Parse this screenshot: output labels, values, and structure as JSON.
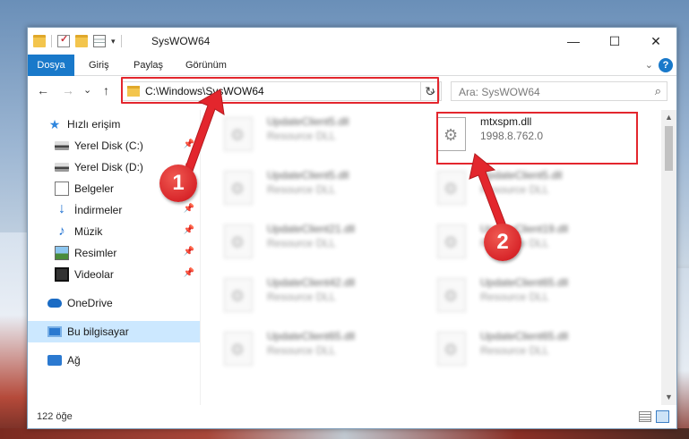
{
  "window": {
    "title": "SysWOW64",
    "controls": {
      "minimize": "—",
      "maximize": "☐",
      "close": "✕"
    }
  },
  "ribbon": {
    "tabs": [
      "Dosya",
      "Giriş",
      "Paylaş",
      "Görünüm"
    ],
    "help": "?"
  },
  "navigation": {
    "back": "←",
    "forward": "→",
    "recent": "⌄",
    "up": "↑",
    "address": "C:\\Windows\\SysWOW64",
    "search_placeholder": "Ara: SysWOW64"
  },
  "sidebar": {
    "items": [
      {
        "label": "Hızlı erişim",
        "icon": "star-icon",
        "pinned": false
      },
      {
        "label": "Yerel Disk (C:)",
        "icon": "drive-icon",
        "pinned": true
      },
      {
        "label": "Yerel Disk (D:)",
        "icon": "drive-icon",
        "pinned": true
      },
      {
        "label": "Belgeler",
        "icon": "documents-icon",
        "pinned": true
      },
      {
        "label": "İndirmeler",
        "icon": "downloads-icon",
        "pinned": true
      },
      {
        "label": "Müzik",
        "icon": "music-icon",
        "pinned": true
      },
      {
        "label": "Resimler",
        "icon": "pictures-icon",
        "pinned": true
      },
      {
        "label": "Videolar",
        "icon": "videos-icon",
        "pinned": true
      },
      {
        "label": "OneDrive",
        "icon": "onedrive-icon",
        "pinned": false
      },
      {
        "label": "Bu bilgisayar",
        "icon": "this-pc-icon",
        "pinned": false,
        "selected": true
      },
      {
        "label": "Ağ",
        "icon": "network-icon",
        "pinned": false
      }
    ]
  },
  "files": {
    "left_column": [
      {
        "name": "UpdateClient5.dll",
        "type": "Resource DLL"
      },
      {
        "name": "UpdateClient5.dll",
        "type": "Resource DLL"
      },
      {
        "name": "UpdateClient21.dll",
        "type": "Resource DLL"
      },
      {
        "name": "UpdateClient42.dll",
        "type": "Resource DLL"
      },
      {
        "name": "UpdateClient65.dll",
        "type": "Resource DLL"
      }
    ],
    "right_column": [
      {
        "name": "mtxspm.dll",
        "type": "1998.8.762.0"
      },
      {
        "name": "UpdateClient5.dll",
        "type": "Resource DLL"
      },
      {
        "name": "UpdateClient19.dll",
        "type": "Resource DLL"
      },
      {
        "name": "UpdateClient65.dll",
        "type": "Resource DLL"
      },
      {
        "name": "UpdateClient65.dll",
        "type": "Resource DLL"
      }
    ]
  },
  "status": {
    "item_count": "122 öğe"
  },
  "annotations": {
    "badge1": "1",
    "badge2": "2",
    "highlight_color": "#e3262d"
  }
}
